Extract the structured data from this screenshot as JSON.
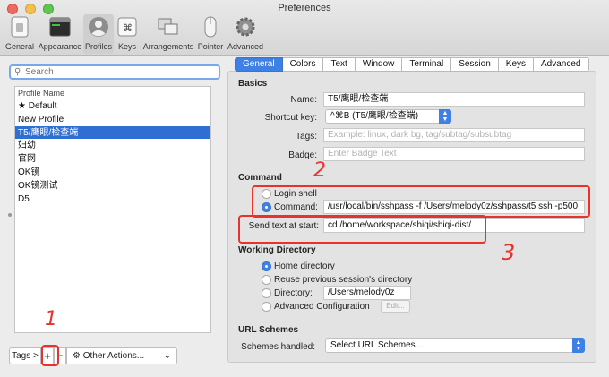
{
  "window": {
    "title": "Preferences"
  },
  "toolbar": {
    "items": [
      {
        "label": "General",
        "icon": "general-icon"
      },
      {
        "label": "Appearance",
        "icon": "appearance-icon"
      },
      {
        "label": "Profiles",
        "icon": "profiles-icon",
        "active": true
      },
      {
        "label": "Keys",
        "icon": "keys-icon"
      },
      {
        "label": "Arrangements",
        "icon": "arrangements-icon"
      },
      {
        "label": "Pointer",
        "icon": "pointer-icon"
      },
      {
        "label": "Advanced",
        "icon": "advanced-gear-icon"
      }
    ]
  },
  "sidebar": {
    "search_placeholder": "Search",
    "column_header": "Profile Name",
    "profiles": [
      "★ Default",
      "New Profile",
      "T5/鹰眼/检查端",
      "妇幼",
      "官网",
      "OK镜",
      "OK镜测试",
      "D5"
    ],
    "selected_index": 2,
    "tags_label": "Tags >",
    "add_label": "+",
    "remove_label": "−",
    "other_actions_label": "Other Actions..."
  },
  "tabs": [
    "General",
    "Colors",
    "Text",
    "Window",
    "Terminal",
    "Session",
    "Keys",
    "Advanced"
  ],
  "active_tab": "General",
  "basics": {
    "heading": "Basics",
    "name_label": "Name:",
    "name_value": "T5/鹰眼/检查端",
    "shortcut_label": "Shortcut key:",
    "shortcut_value": "^⌘B (T5/鹰眼/检查端)",
    "tags_label": "Tags:",
    "tags_placeholder": "Example: linux, dark bg, tag/subtag/subsubtag",
    "badge_label": "Badge:",
    "badge_placeholder": "Enter Badge Text"
  },
  "command": {
    "heading": "Command",
    "login_shell_label": "Login shell",
    "command_label": "Command:",
    "command_value": "/usr/local/bin/sshpass -f /Users/melody0z/sshpass/t5 ssh -p500",
    "send_text_label": "Send text at start:",
    "send_text_value": "cd /home/workspace/shiqi/shiqi-dist/"
  },
  "working_directory": {
    "heading": "Working Directory",
    "home_label": "Home directory",
    "reuse_label": "Reuse previous session's directory",
    "directory_label": "Directory:",
    "directory_value": "/Users/melody0z",
    "advanced_label": "Advanced Configuration",
    "edit_label": "Edit..."
  },
  "url_schemes": {
    "heading": "URL Schemes",
    "handled_label": "Schemes handled:",
    "select_value": "Select URL Schemes..."
  },
  "annotations": {
    "one": "1",
    "two": "2",
    "three": "3"
  },
  "colors": {
    "accent": "#3f80e5",
    "selection": "#2f6fd4",
    "annotation": "#e8322c"
  }
}
